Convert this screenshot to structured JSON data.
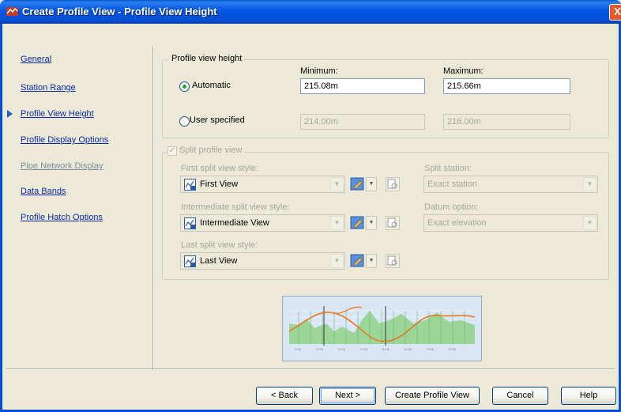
{
  "window": {
    "title": "Create Profile View - Profile View Height",
    "close_glyph": "X"
  },
  "nav": {
    "items": [
      {
        "label": "General",
        "active": false,
        "disabled": false
      },
      {
        "label": "Station Range",
        "active": false,
        "disabled": false
      },
      {
        "label": "Profile View Height",
        "active": true,
        "disabled": false
      },
      {
        "label": "Profile Display Options",
        "active": false,
        "disabled": false
      },
      {
        "label": "Pipe Network Display",
        "active": false,
        "disabled": true
      },
      {
        "label": "Data Bands",
        "active": false,
        "disabled": false
      },
      {
        "label": "Profile Hatch Options",
        "active": false,
        "disabled": false
      }
    ]
  },
  "height_group": {
    "label": "Profile view height",
    "minimum_label": "Minimum:",
    "maximum_label": "Maximum:",
    "automatic": {
      "label": "Automatic",
      "selected": true,
      "min": "215.08m",
      "max": "215.66m"
    },
    "user_specified": {
      "label": "User specified",
      "selected": false,
      "min": "214.00m",
      "max": "216.00m"
    }
  },
  "split_group": {
    "label": "Split profile view",
    "checked": true,
    "first_label": "First split view style:",
    "first_value": "First View",
    "intermediate_label": "Intermediate split view style:",
    "intermediate_value": "Intermediate View",
    "last_label": "Last split view style:",
    "last_value": "Last View",
    "split_station_label": "Split station:",
    "split_station_value": "Exact station",
    "datum_label": "Datum option:",
    "datum_value": "Exact elevation"
  },
  "preview": {
    "stations": [
      "1+00",
      "2+00",
      "3+00",
      "4+00",
      "5+00",
      "6+00",
      "7+00",
      "8+00"
    ],
    "colors": {
      "ground": "#8fd18a",
      "profile": "#e8761a",
      "grid": "#ffffff",
      "background": "#d9e6f6"
    }
  },
  "buttons": {
    "back": "< Back",
    "next": "Next >",
    "create": "Create Profile View",
    "cancel": "Cancel",
    "help": "Help"
  }
}
